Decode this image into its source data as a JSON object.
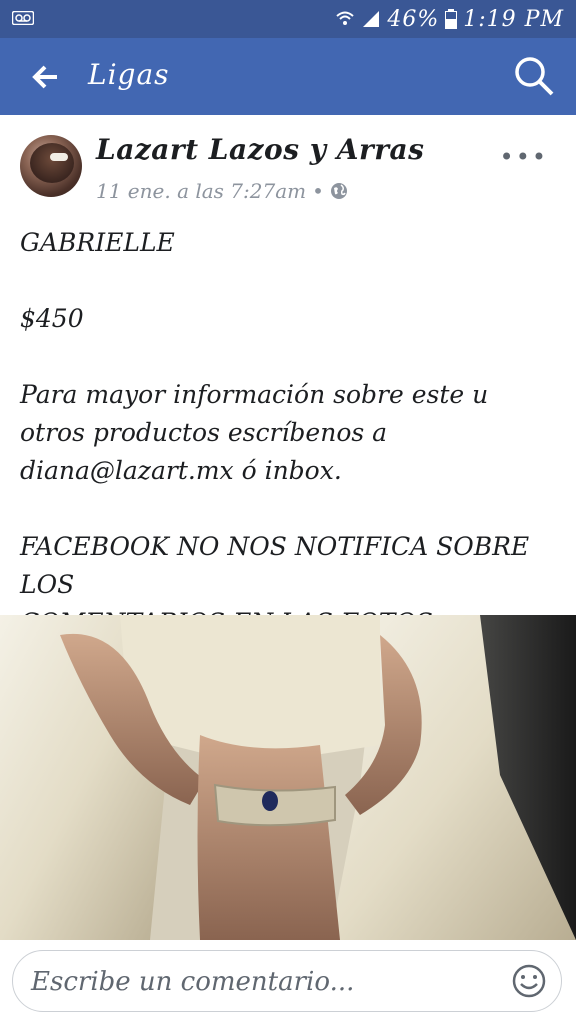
{
  "status_bar": {
    "battery": "46%",
    "time": "1:19 PM"
  },
  "app_bar": {
    "title": "Ligas"
  },
  "post": {
    "author": "Lazart Lazos y Arras",
    "timestamp": "11 ene. a las 7:27am",
    "privacy_icon": "globe-icon",
    "text": {
      "line1": "GABRIELLE",
      "price": "$450",
      "info_1": "Para mayor información sobre este u",
      "info_2": "otros productos escríbenos a",
      "info_3": "diana@lazart.mx ó inbox.",
      "notice_1": "FACEBOOK NO NOS NOTIFICA SOBRE LOS",
      "notice_2": "COMENTARIOS EN LAS FOTOS"
    }
  },
  "comment": {
    "placeholder": "Escribe un comentario..."
  },
  "colors": {
    "status_bar": "#3a5795",
    "app_bar": "#4267b2",
    "text": "#1c1e21",
    "meta": "#8d949e"
  }
}
